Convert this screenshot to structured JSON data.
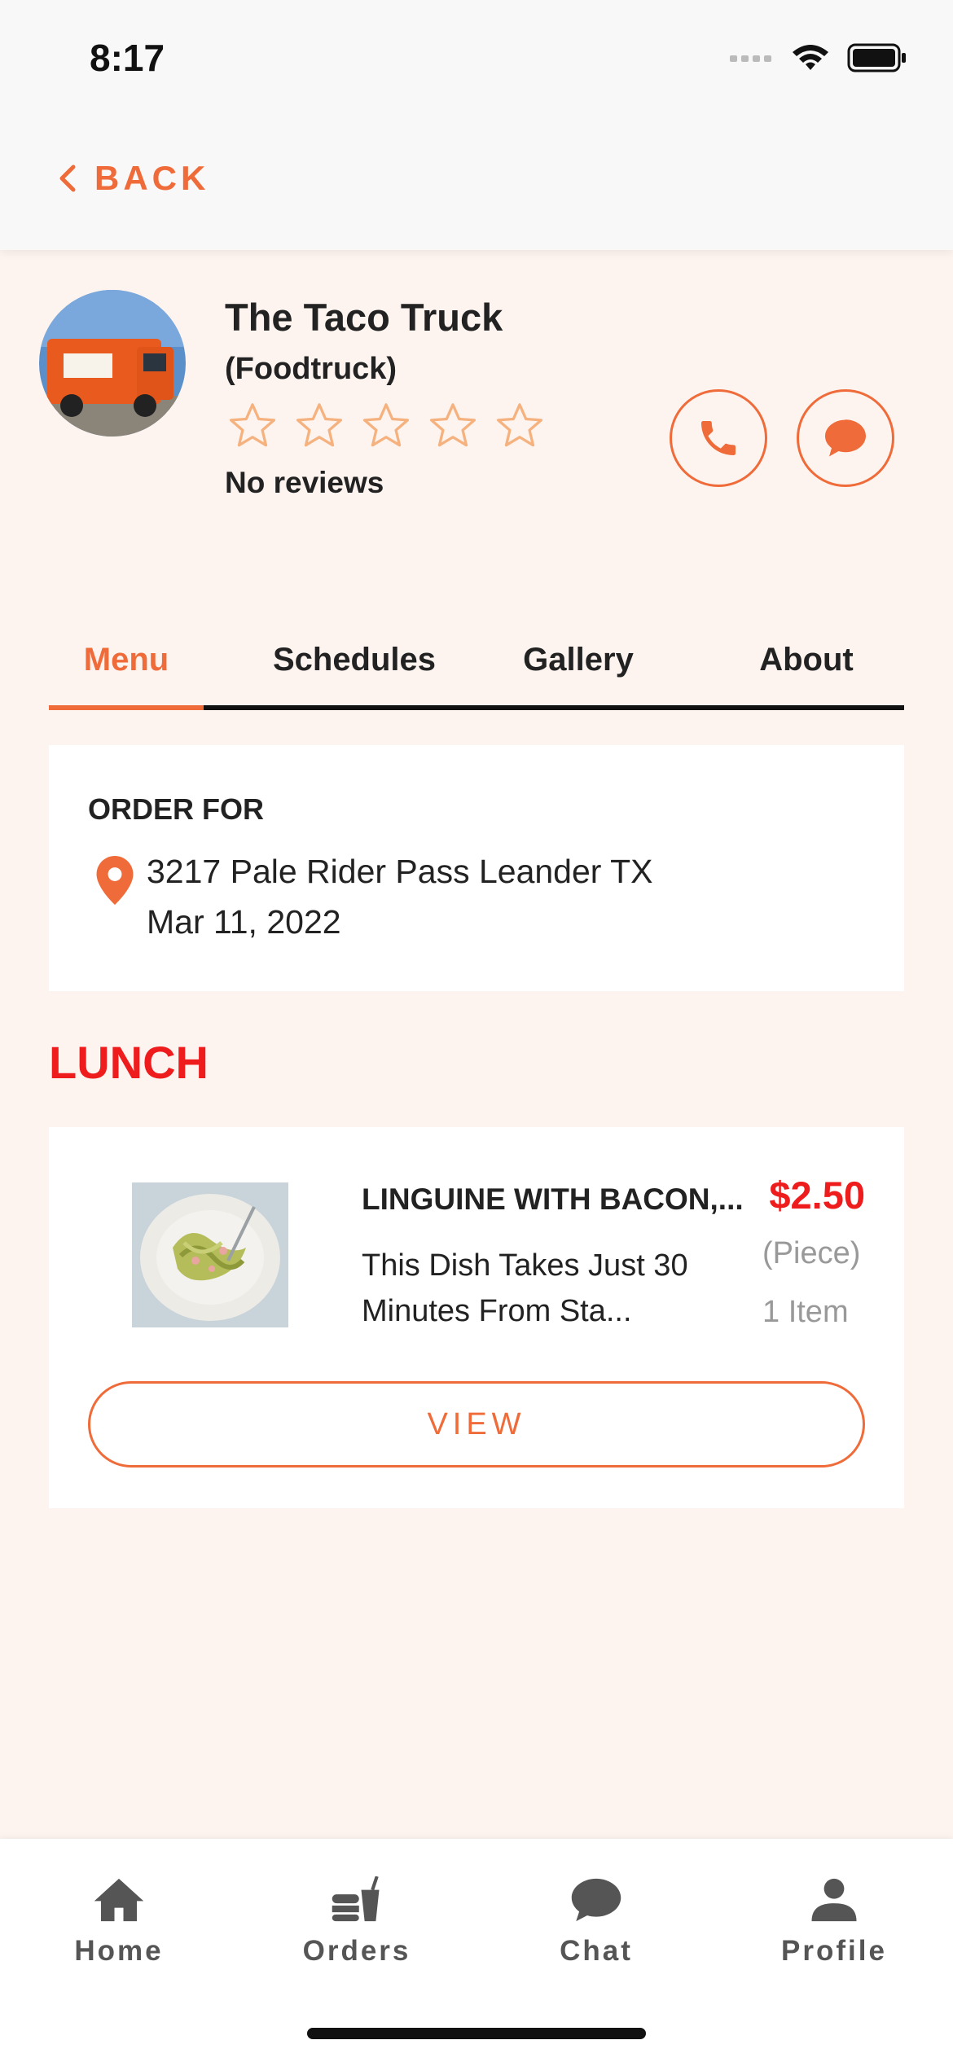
{
  "status_bar": {
    "time": "8:17"
  },
  "header": {
    "back_label": "BACK"
  },
  "vendor": {
    "name": "The Taco Truck",
    "type": "(Foodtruck)",
    "rating": 0,
    "rating_max": 5,
    "reviews_text": "No reviews"
  },
  "tabs": [
    {
      "label": "Menu",
      "active": true
    },
    {
      "label": "Schedules",
      "active": false
    },
    {
      "label": "Gallery",
      "active": false
    },
    {
      "label": "About",
      "active": false
    }
  ],
  "order": {
    "title": "ORDER FOR",
    "address": "3217 Pale Rider Pass Leander TX",
    "date": "Mar 11, 2022"
  },
  "section": {
    "title": "LUNCH"
  },
  "menu_item": {
    "name": "LINGUINE WITH BACON,...",
    "description": "This Dish Takes Just 30 Minutes From Sta...",
    "price": "$2.50",
    "unit": "(Piece)",
    "quantity": "1 Item",
    "button_label": "VIEW"
  },
  "bottom_nav": [
    {
      "label": "Home",
      "icon": "home-icon"
    },
    {
      "label": "Orders",
      "icon": "orders-icon"
    },
    {
      "label": "Chat",
      "icon": "chat-icon"
    },
    {
      "label": "Profile",
      "icon": "profile-icon"
    }
  ],
  "colors": {
    "accent": "#ef6c3a",
    "price": "#ee1c1c",
    "background": "#fdf3ef"
  }
}
